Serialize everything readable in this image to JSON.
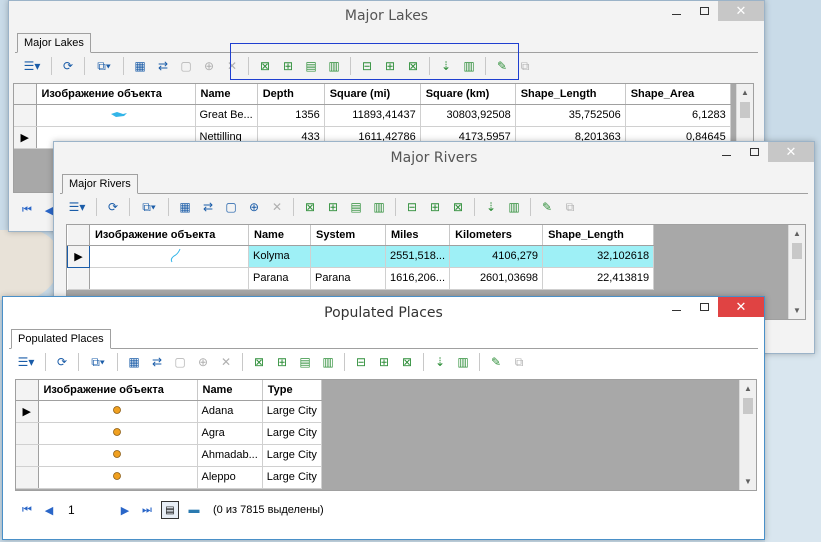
{
  "lakes": {
    "title": "Major Lakes",
    "tab": "Major Lakes",
    "columns": [
      "Изображение объекта",
      "Name",
      "Depth",
      "Square (mi)",
      "Square (km)",
      "Shape_Length",
      "Shape_Area"
    ],
    "rows": [
      [
        "Great Be...",
        "1356",
        "11893,41437",
        "30803,92508",
        "35,752506",
        "6,1283"
      ],
      [
        "Nettilling",
        "433",
        "1611,42786",
        "4173,5957",
        "8,201363",
        "0,84645"
      ]
    ]
  },
  "rivers": {
    "title": "Major Rivers",
    "tab": "Major Rivers",
    "columns": [
      "Изображение объекта",
      "Name",
      "System",
      "Miles",
      "Kilometers",
      "Shape_Length"
    ],
    "rows": [
      [
        "Kolyma",
        "",
        "2551,518...",
        "4106,279",
        "32,102618"
      ],
      [
        "Parana",
        "Parana",
        "1616,206...",
        "2601,03698",
        "22,413819"
      ]
    ]
  },
  "places": {
    "title": "Populated Places",
    "tab": "Populated Places",
    "columns": [
      "Изображение объекта",
      "Name",
      "Type"
    ],
    "rows": [
      [
        "Adana",
        "Large City"
      ],
      [
        "Agra",
        "Large City"
      ],
      [
        "Ahmadab...",
        "Large City"
      ],
      [
        "Aleppo",
        "Large City"
      ]
    ],
    "page": "1",
    "status": "(0 из 7815 выделены)"
  },
  "colors": {
    "selected_row": "#9ef0f6",
    "active_close": "#e04343",
    "point_marker": "#f0a020"
  }
}
